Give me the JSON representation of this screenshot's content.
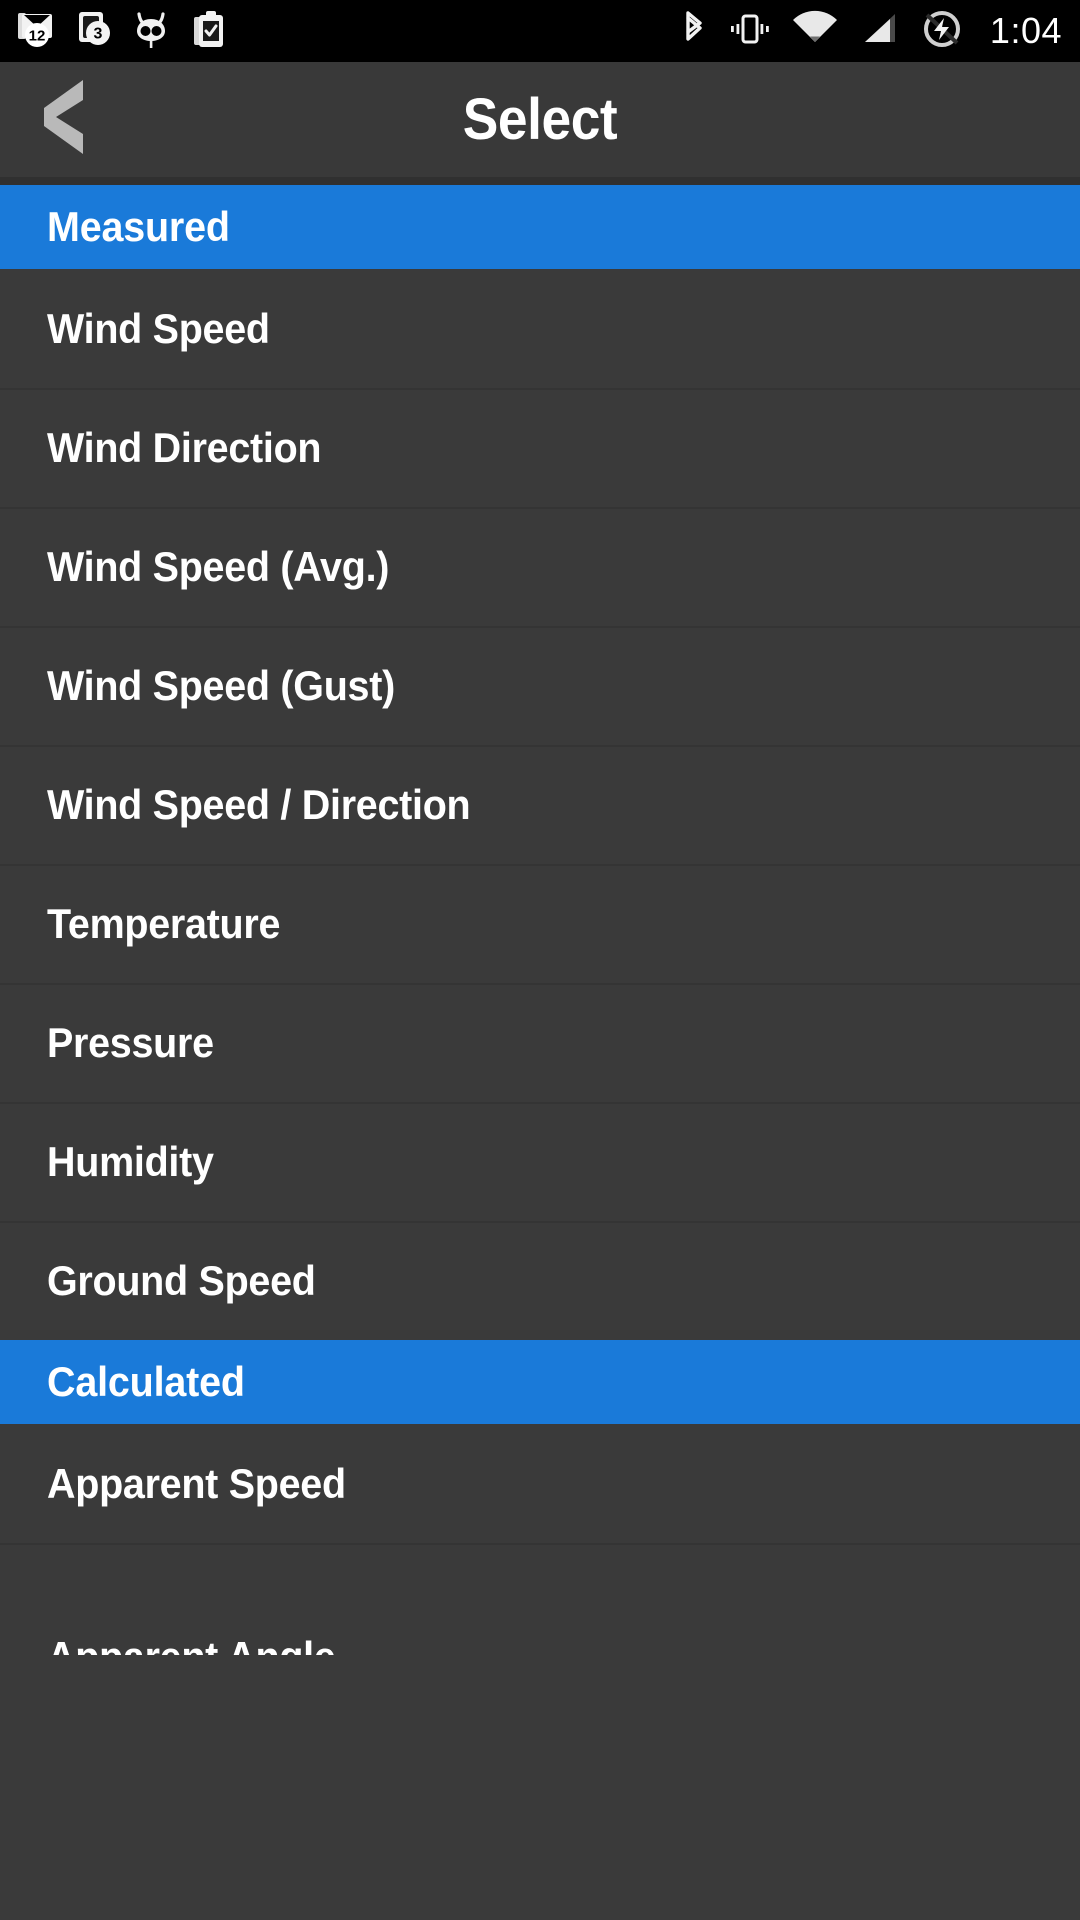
{
  "status_bar": {
    "icons_left": [
      {
        "name": "mail-cat-icon",
        "badge": "12"
      },
      {
        "name": "messaging-icon",
        "badge": "3"
      },
      {
        "name": "cyanogenmod-icon",
        "badge": ""
      },
      {
        "name": "clipboard-check-icon",
        "badge": ""
      }
    ],
    "icons_right": [
      {
        "name": "bluetooth-icon"
      },
      {
        "name": "vibrate-icon"
      },
      {
        "name": "wifi-icon"
      },
      {
        "name": "cellular-signal-icon"
      },
      {
        "name": "battery-charging-icon"
      }
    ],
    "clock": "1:04"
  },
  "app_bar": {
    "title": "Select",
    "back_icon": "chevron-left-icon"
  },
  "colors": {
    "accent_blue": "#1a7ad9",
    "list_background": "#3a3a3a",
    "app_bar_background": "#393939",
    "status_bar_background": "#000000",
    "divider": "#343434",
    "text_primary": "#ffffff",
    "back_icon": "#b9b9b9"
  },
  "list": {
    "sections": [
      {
        "header": "Measured",
        "items": [
          "Wind Speed",
          "Wind Direction",
          "Wind Speed (Avg.)",
          "Wind Speed (Gust)",
          "Wind Speed / Direction",
          "Temperature",
          "Pressure",
          "Humidity",
          "Ground Speed"
        ]
      },
      {
        "header": "Calculated",
        "items": [
          "Apparent Speed",
          "Apparent Angle"
        ]
      }
    ]
  }
}
